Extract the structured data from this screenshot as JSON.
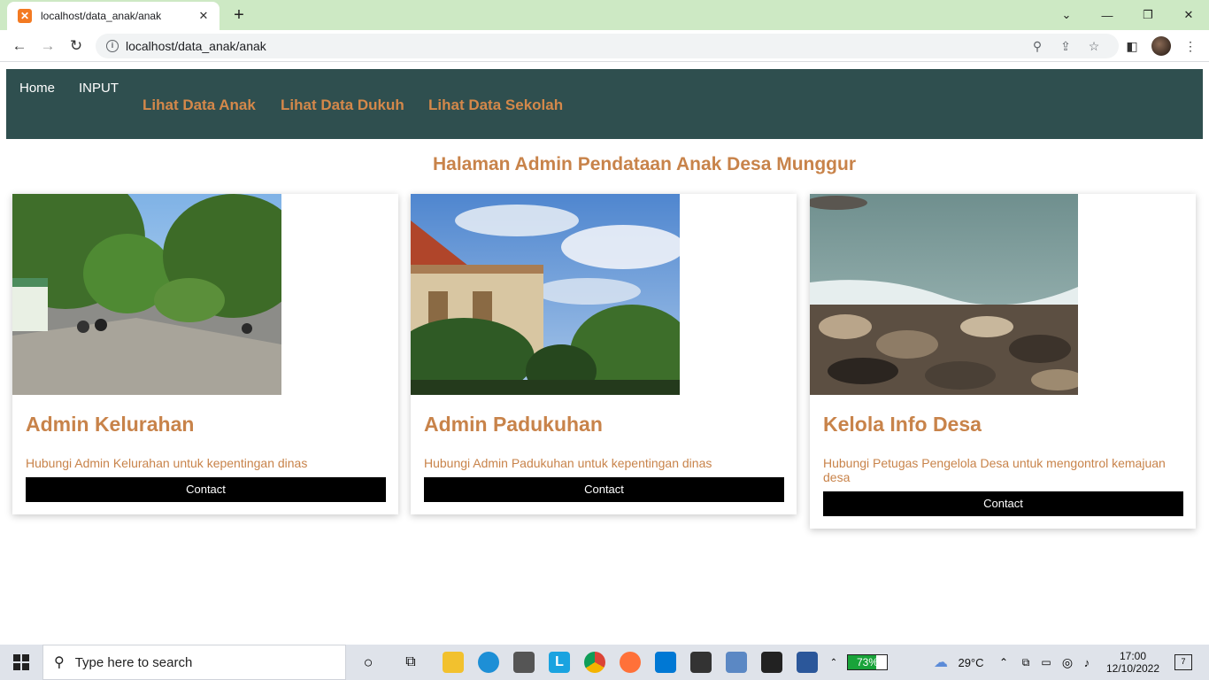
{
  "browser": {
    "tab_title": "localhost/data_anak/anak",
    "url": "localhost/data_anak/anak"
  },
  "nav": {
    "home": "Home",
    "input": "INPUT",
    "links": [
      "Lihat Data Anak",
      "Lihat Data Dukuh",
      "Lihat Data Sekolah"
    ]
  },
  "heading": "Halaman Admin Pendataan Anak Desa Munggur",
  "cards": [
    {
      "title": "Admin Kelurahan",
      "text": "Hubungi Admin Kelurahan untuk kepentingan dinas",
      "button": "Contact",
      "image": "street-photo"
    },
    {
      "title": "Admin Padukuhan",
      "text": "Hubungi Admin Padukuhan untuk kepentingan dinas",
      "button": "Contact",
      "image": "building-photo"
    },
    {
      "title": "Kelola Info Desa",
      "text": "Hubungi Petugas Pengelola Desa untuk mengontrol kemajuan desa",
      "button": "Contact",
      "image": "sea-rocks-photo"
    }
  ],
  "taskbar": {
    "search_placeholder": "Type here to search",
    "battery": "73%",
    "temperature": "29°C",
    "time": "17:00",
    "date": "12/10/2022",
    "notifications": "7"
  }
}
